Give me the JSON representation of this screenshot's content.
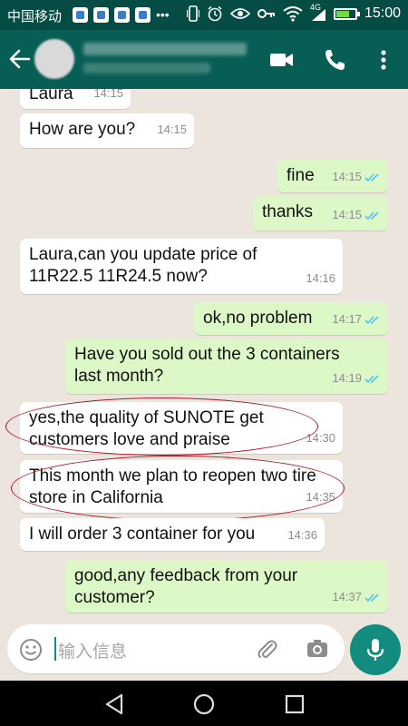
{
  "status_bar": {
    "carrier": "中国移动",
    "network": "4G",
    "time": "15:00"
  },
  "app_bar": {
    "contact_name": "",
    "contact_status": ""
  },
  "messages": [
    {
      "dir": "in",
      "text": "Laura",
      "time": "14:15"
    },
    {
      "dir": "in",
      "text": "How are you?",
      "time": "14:15"
    },
    {
      "dir": "out",
      "text": "fine",
      "time": "14:15",
      "read": true
    },
    {
      "dir": "out",
      "text": "thanks",
      "time": "14:15",
      "read": true
    },
    {
      "dir": "in",
      "text": "Laura,can you update price of 11R22.5 11R24.5 now?",
      "time": "14:16"
    },
    {
      "dir": "out",
      "text": "ok,no problem",
      "time": "14:17",
      "read": true
    },
    {
      "dir": "out",
      "text": "Have you sold out the 3 containers last month?",
      "time": "14:19",
      "read": true
    },
    {
      "dir": "in",
      "text": "yes,the quality of SUNOTE get customers love and praise",
      "time": "14:30",
      "highlighted": true
    },
    {
      "dir": "in",
      "text": "This month we plan to reopen two tire store in California",
      "time": "14:35",
      "highlighted": true
    },
    {
      "dir": "in",
      "text": "I will order 3 container for you",
      "time": "14:36"
    },
    {
      "dir": "out",
      "text": "good,any feedback from your customer?",
      "time": "14:37",
      "read": true
    }
  ],
  "input": {
    "placeholder": "输入信息"
  },
  "colors": {
    "header": "#075e54",
    "status_bar": "#054d44",
    "accent": "#128c7e",
    "outgoing_bubble": "#dcf8c6",
    "incoming_bubble": "#ffffff",
    "read_tick": "#4fc3f7",
    "annotation": "#b0182a"
  }
}
